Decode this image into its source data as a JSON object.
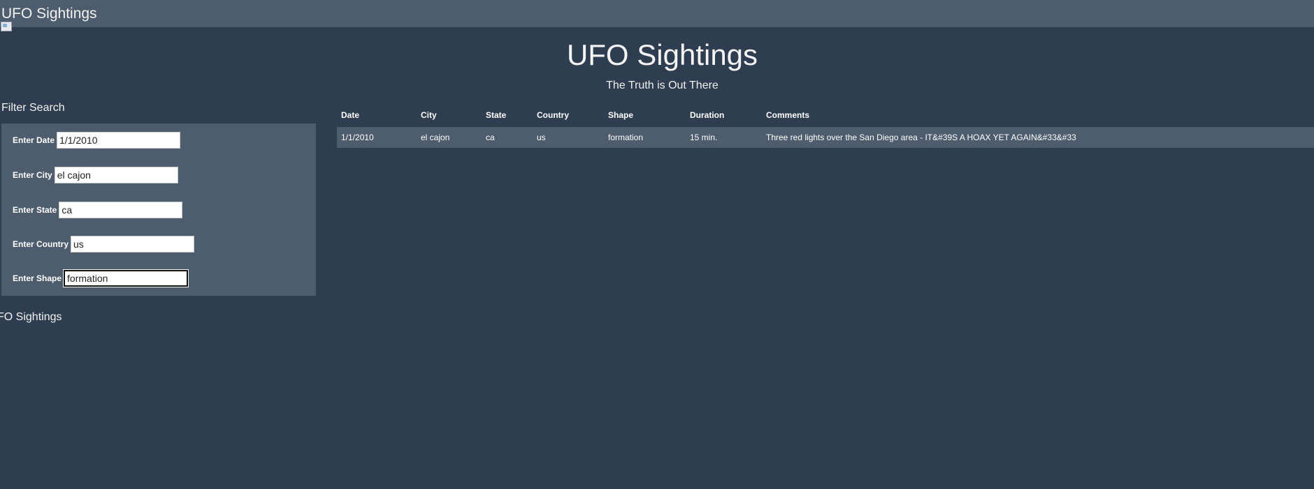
{
  "navbar": {
    "brand": "UFO Sightings"
  },
  "hero": {
    "title": "UFO Sightings",
    "subtitle": "The Truth is Out There"
  },
  "filters": {
    "title": "Filter Search",
    "fields": [
      {
        "label": "Enter Date",
        "value": "1/1/2010"
      },
      {
        "label": "Enter City",
        "value": "el cajon"
      },
      {
        "label": "Enter State",
        "value": "ca"
      },
      {
        "label": "Enter Country",
        "value": "us"
      },
      {
        "label": "Enter Shape",
        "value": "formation"
      }
    ]
  },
  "table": {
    "columns": [
      "Date",
      "City",
      "State",
      "Country",
      "Shape",
      "Duration",
      "Comments"
    ],
    "rows": [
      [
        "1/1/2010",
        "el cajon",
        "ca",
        "us",
        "formation",
        "15 min.",
        "Three red lights over the San Diego area - IT&#39S A HOAX YET AGAIN&#33&#33"
      ]
    ]
  },
  "footer": {
    "text": "FO Sightings"
  }
}
